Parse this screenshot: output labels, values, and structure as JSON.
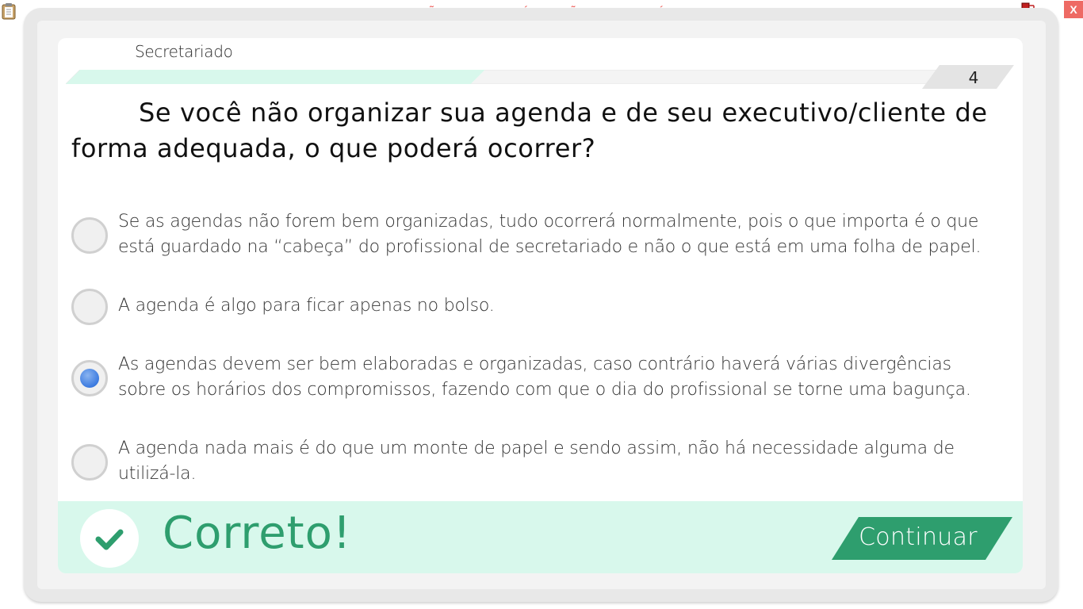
{
  "app": {
    "banner": "VERSÃO PARA FUNCIONÁRIOS - NÃO COMERCIALIZÁVEL",
    "close_label": "X"
  },
  "header": {
    "subject": "Secretariado",
    "page_number": "4",
    "progress_fraction": 0.46
  },
  "question": {
    "text": "Se você não organizar sua agenda e de seu executivo/cliente de forma adequada, o que poderá ocorrer?"
  },
  "options": [
    {
      "text": "Se as agendas não forem bem organizadas, tudo ocorrerá normalmente, pois o que importa é o que está guardado na “cabeça” do profissional de secretariado e não o que está em uma folha de papel.",
      "selected": false
    },
    {
      "text": "A agenda é algo para ficar apenas no bolso.",
      "selected": false
    },
    {
      "text": "As agendas devem ser bem elaboradas e organizadas, caso contrário haverá várias divergências sobre os horários dos compromissos, fazendo com que o dia do profissional se torne uma bagunça.",
      "selected": true
    },
    {
      "text": "A agenda nada mais é do que um monte de papel e sendo assim, não há necessidade alguma de utilizá-la.",
      "selected": false
    }
  ],
  "feedback": {
    "result": "Correto!",
    "continue_label": "Continuar"
  },
  "colors": {
    "accent": "#2e9e6e",
    "feedback_bg": "#d8f8ec",
    "progress_fill": "#d8f8ec",
    "banner_text": "#ee5b57",
    "close_bg": "#ee6a64",
    "radio_selected": "#3c7be0"
  },
  "icons": {
    "top_left": "clipboard-icon",
    "top_right": "network-status-icon",
    "feedback": "checkmark-icon"
  }
}
